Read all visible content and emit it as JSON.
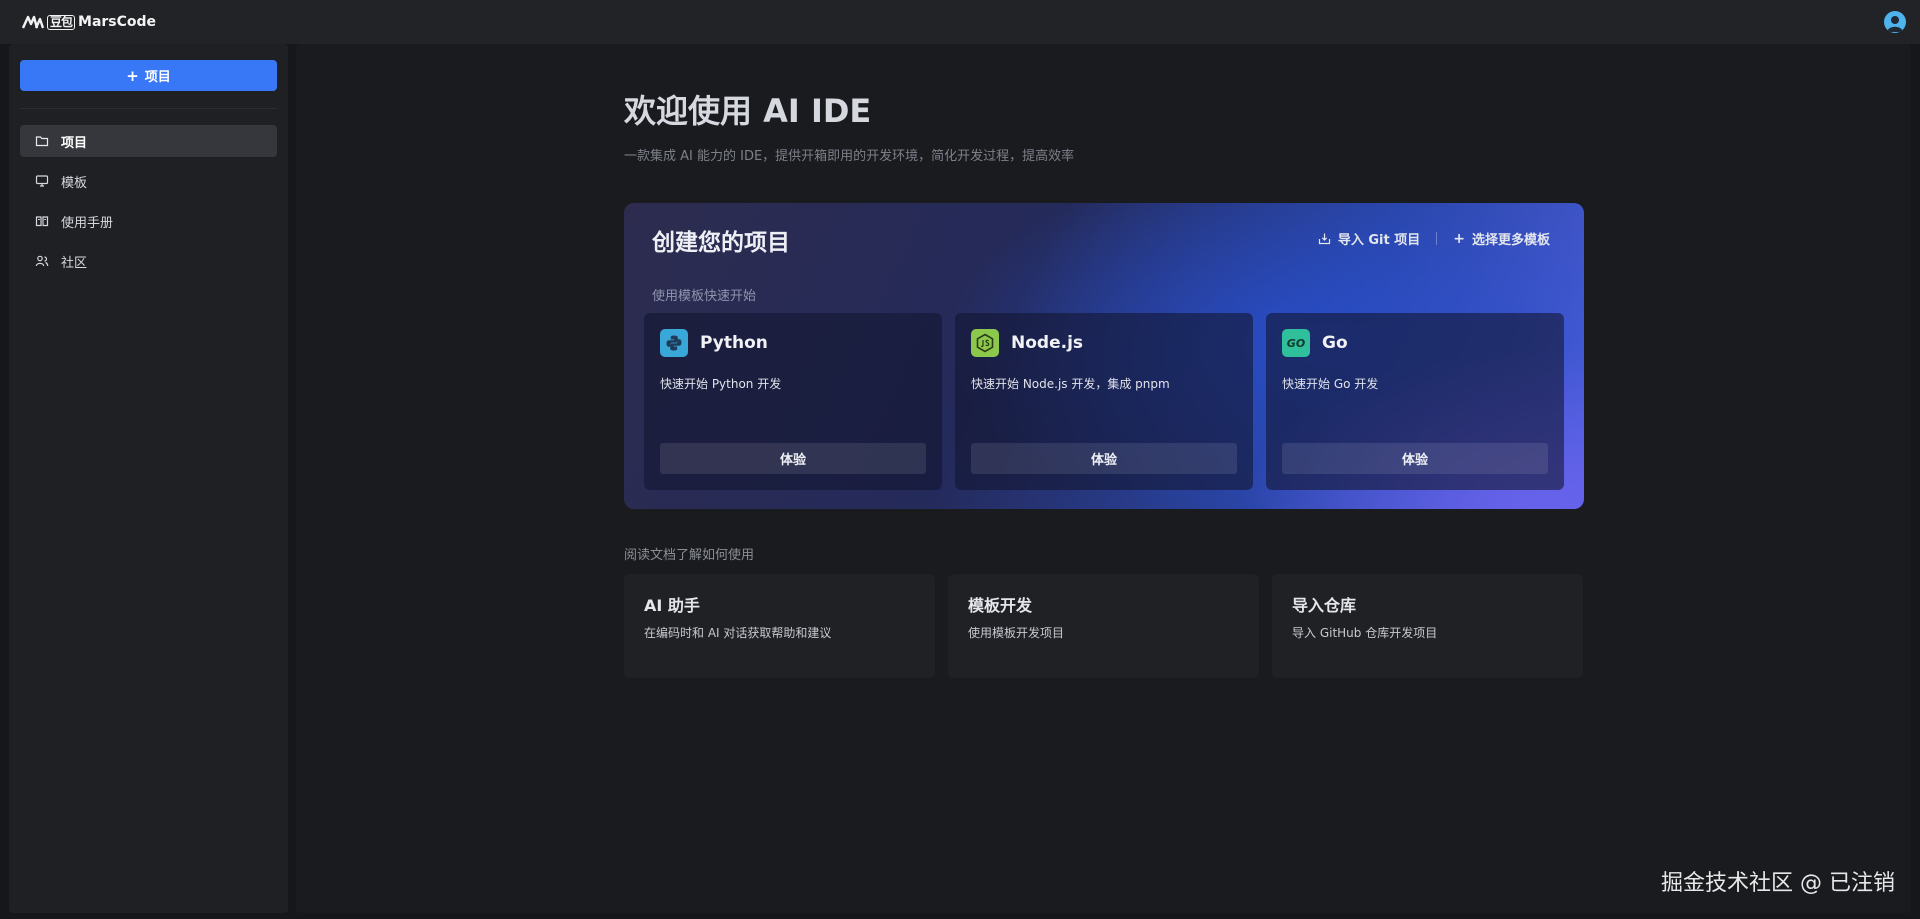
{
  "app": {
    "logo_cn": "豆包",
    "logo_text": "MarsCode"
  },
  "sidebar": {
    "new_button": {
      "icon": "plus-icon",
      "label": "项目"
    },
    "items": [
      {
        "label": "项目",
        "icon": "folder-icon",
        "active": true
      },
      {
        "label": "模板",
        "icon": "monitor-icon",
        "active": false
      },
      {
        "label": "使用手册",
        "icon": "book-icon",
        "active": false
      },
      {
        "label": "社区",
        "icon": "users-icon",
        "active": false
      }
    ]
  },
  "main": {
    "title": "欢迎使用 AI IDE",
    "subtitle": "一款集成 AI 能力的 IDE，提供开箱即用的开发环境，简化开发过程，提高效率",
    "hero": {
      "title": "创建您的项目",
      "import_git": "导入 Git 项目",
      "more_templates": "选择更多模板",
      "quick_start_label": "使用模板快速开始",
      "templates": [
        {
          "name": "Python",
          "desc": "快速开始 Python 开发",
          "button": "体验",
          "icon": "python-icon"
        },
        {
          "name": "Node.js",
          "desc": "快速开始 Node.js 开发，集成 pnpm",
          "button": "体验",
          "icon": "nodejs-icon"
        },
        {
          "name": "Go",
          "desc": "快速开始 Go 开发",
          "button": "体验",
          "icon": "go-icon",
          "icon_text": "GO"
        }
      ]
    },
    "docs_label": "阅读文档了解如何使用",
    "docs": [
      {
        "title": "AI 助手",
        "desc": "在编码时和 AI 对话获取帮助和建议"
      },
      {
        "title": "模板开发",
        "desc": "使用模板开发项目"
      },
      {
        "title": "导入仓库",
        "desc": "导入 GitHub 仓库开发项目"
      }
    ]
  },
  "watermark": "掘金技术社区 @ 已注销",
  "colors": {
    "accent": "#3877f6",
    "python_icon_bg": "#3aa7d9",
    "nodejs_icon_bg": "#8cc84b",
    "go_icon_bg": "#2fbf9a"
  }
}
